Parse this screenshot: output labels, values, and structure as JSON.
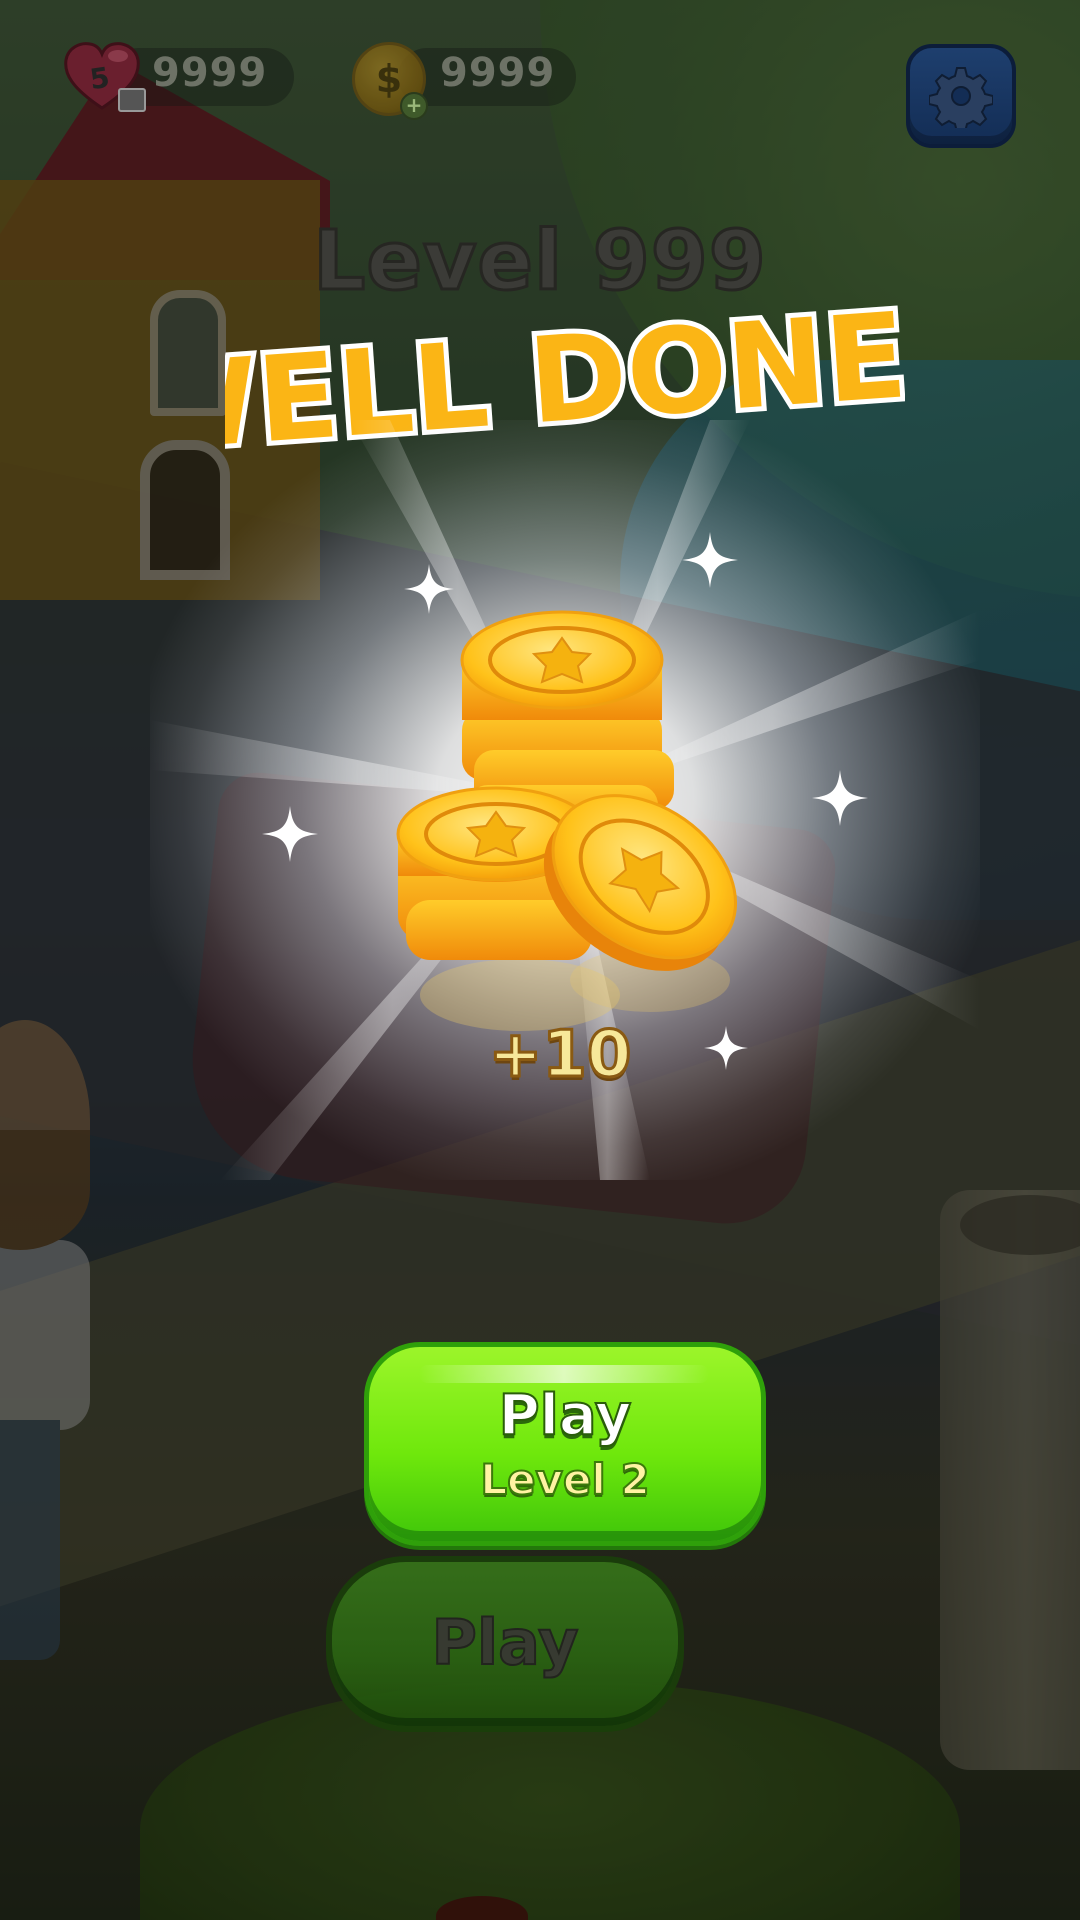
{
  "hud": {
    "lives_count": "5",
    "lives_value": "9999",
    "coins_value": "9999",
    "coin_symbol": "$",
    "coin_add": "+"
  },
  "title": {
    "level": "Level 999",
    "headline": "WELL DONE !"
  },
  "reward": {
    "amount": "+10",
    "icon": "gold-coin-stack-icon"
  },
  "buttons": {
    "next_play_label": "Play",
    "next_level_label": "Level 2",
    "replay_label": "Play"
  },
  "colors": {
    "headline_fill": "#FBB515",
    "headline_stroke": "#FFFFFF",
    "next_button": "#7CF01A",
    "settings_button": "#1A3A66"
  }
}
